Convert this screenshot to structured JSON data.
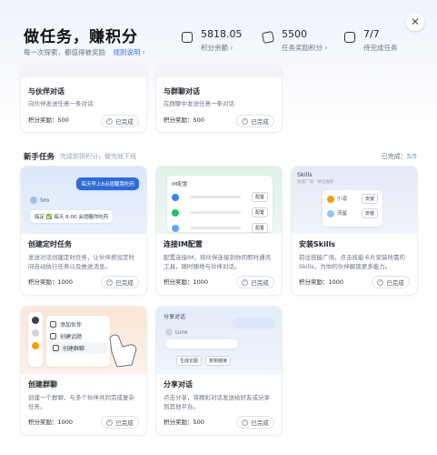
{
  "header": {
    "title": "做任务，赚积分",
    "subtitle": "每一次探索，都值得被奖励",
    "rules_link": "规则说明",
    "rules_arrow": "›",
    "close_glyph": "✕"
  },
  "stats": [
    {
      "value": "5818.05",
      "label": "积分余额 ›",
      "icon": "wallet-icon"
    },
    {
      "value": "5500",
      "label": "任务奖励积分 ›",
      "icon": "gift-icon"
    },
    {
      "value": "7/7",
      "label": "待完成任务",
      "icon": "calendar-icon"
    }
  ],
  "top_tasks": [
    {
      "title": "与伙伴对话",
      "desc": "向伙伴发送任意一条对话",
      "reward": "积分奖励：500",
      "status": "已完成"
    },
    {
      "title": "与群聊对话",
      "desc": "在群聊中发送任意一条对话",
      "reward": "积分奖励：500",
      "status": "已完成"
    }
  ],
  "newbie": {
    "title": "新手任务",
    "note": "完成即得积分，做完就下线",
    "progress_label": "已完成：",
    "progress_value": "5/5"
  },
  "tasks": [
    {
      "title": "创建定时任务",
      "desc": "发送对话创建定时任务，让伙伴按设定时间自动执行任务以及推送消息。",
      "reward": "积分奖励：1000",
      "status": "已完成",
      "hero": {
        "bubble": "每天早上8点提醒我吃药",
        "bot_name": "Sea",
        "reply": "搞定 ✅ 每天 8:00 会提醒你吃药"
      }
    },
    {
      "title": "连接IM配置",
      "desc": "配置连接IM，将伙伴连接到你的即时通讯工具，随时随地与伙伴对话。",
      "reward": "积分奖励：1000",
      "status": "已完成",
      "hero": {
        "panel_title": "IM配置",
        "btn": "配置"
      }
    },
    {
      "title": "安装Skills",
      "desc": "前往技能广场，点击技能卡片安装所需的Skills，为你的伙伴解锁更多能力。",
      "reward": "积分奖励：1000",
      "status": "已完成",
      "hero": {
        "label": "Skills",
        "hint": "技能广场 · 精选推荐",
        "skill1": "小凛",
        "skill2": "流星",
        "btn": "安装"
      }
    },
    {
      "title": "创建群聊",
      "desc": "创建一个群聊，与多个伙伴共同完成复杂任务。",
      "reward": "积分奖励：1000",
      "status": "已完成",
      "hero": {
        "menu": [
          "添加伙伴",
          "创建话题",
          "创建群聊"
        ]
      }
    },
    {
      "title": "分享对话",
      "desc": "点击分享，将精彩对话发送给好友或分享到其他平台。",
      "reward": "积分奖励：500",
      "status": "已完成",
      "hero": {
        "label": "分享对话",
        "bot_name": "Luna",
        "btn1": "生成长图",
        "btn2": "复制链接"
      }
    }
  ],
  "done_glyph": "✓",
  "colors": {
    "accent": "#3370ff",
    "progress": "#3b9dd8"
  }
}
